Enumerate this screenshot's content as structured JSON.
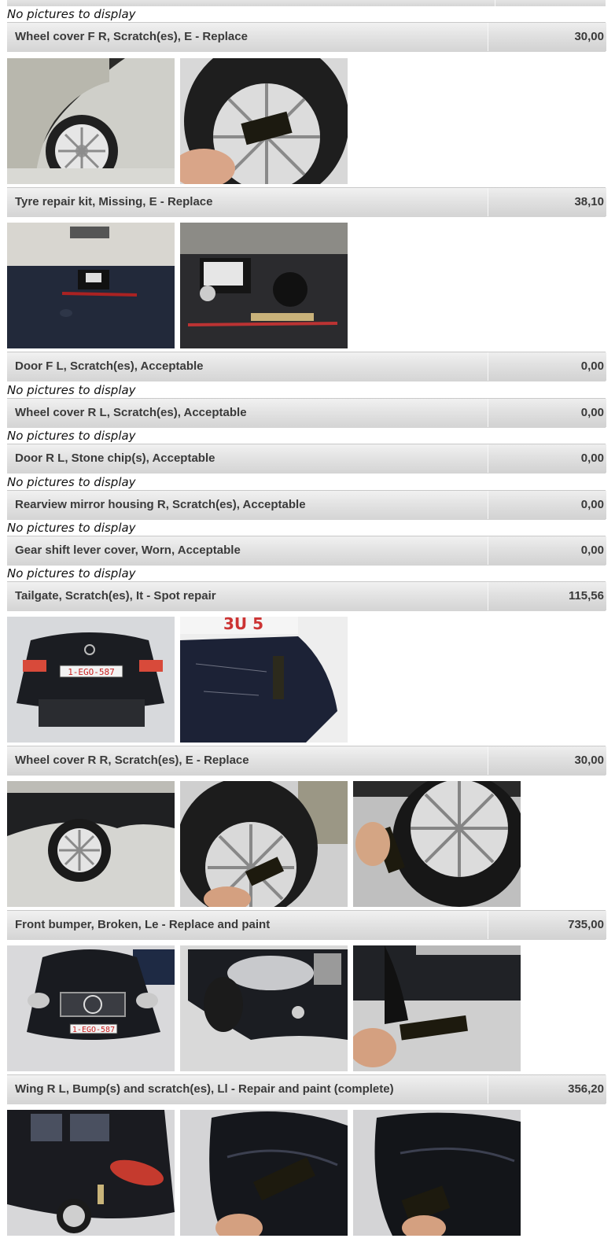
{
  "no_pictures_text": "No pictures to display",
  "items": [
    {
      "description": "Wheel cover F R, Scratch(es), E - Replace",
      "cost": "30,00",
      "photos": [
        "wheel-cover-f-r-photo-1",
        "wheel-cover-f-r-photo-2"
      ]
    },
    {
      "description": "Tyre repair kit, Missing, E - Replace",
      "cost": "38,10",
      "photos": [
        "tyre-repair-kit-photo-1",
        "tyre-repair-kit-photo-2"
      ]
    },
    {
      "description": "Door F L, Scratch(es), Acceptable",
      "cost": "0,00",
      "photos": []
    },
    {
      "description": "Wheel cover R L, Scratch(es), Acceptable",
      "cost": "0,00",
      "photos": []
    },
    {
      "description": "Door R L, Stone chip(s), Acceptable",
      "cost": "0,00",
      "photos": []
    },
    {
      "description": "Rearview mirror housing R, Scratch(es), Acceptable",
      "cost": "0,00",
      "photos": []
    },
    {
      "description": "Gear shift lever cover, Worn, Acceptable",
      "cost": "0,00",
      "photos": []
    },
    {
      "description": "Tailgate, Scratch(es), It - Spot repair",
      "cost": "115,56",
      "photos": [
        "tailgate-photo-1",
        "tailgate-photo-2"
      ]
    },
    {
      "description": "Wheel cover R R, Scratch(es), E - Replace",
      "cost": "30,00",
      "photos": [
        "wheel-cover-r-r-photo-1",
        "wheel-cover-r-r-photo-2",
        "wheel-cover-r-r-photo-3"
      ]
    },
    {
      "description": "Front bumper, Broken, Le - Replace and paint",
      "cost": "735,00",
      "photos": [
        "front-bumper-photo-1",
        "front-bumper-photo-2",
        "front-bumper-photo-3"
      ]
    },
    {
      "description": "Wing R L, Bump(s) and scratch(es), Ll - Repair and paint (complete)",
      "cost": "356,20",
      "photos": [
        "wing-r-l-photo-1",
        "wing-r-l-photo-2",
        "wing-r-l-photo-3"
      ]
    }
  ],
  "plate_text": "1-EGO-587",
  "colors": {
    "row_top": "#f1f1f1",
    "row_bottom": "#d4d4d4",
    "text": "#3a3a3a",
    "car_body": "#1b1d22"
  }
}
